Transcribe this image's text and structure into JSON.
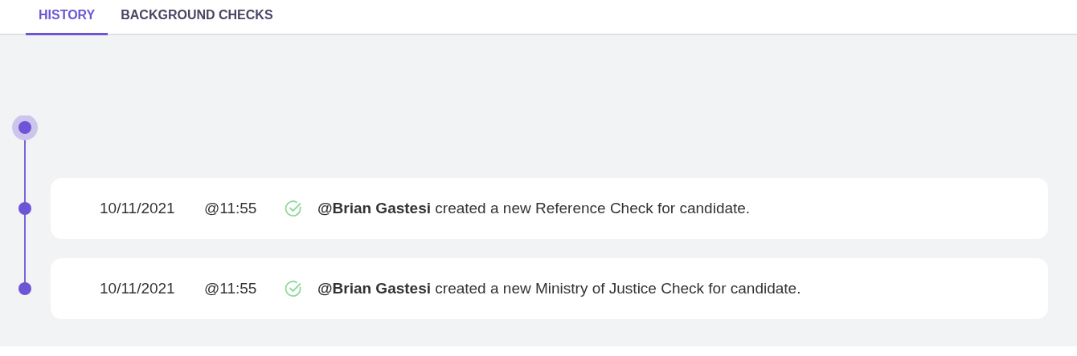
{
  "tabs": [
    {
      "label": "HISTORY",
      "selected": true
    },
    {
      "label": "BACKGROUND CHECKS",
      "selected": false
    }
  ],
  "history": [
    {
      "date": "10/11/2021",
      "time": "@11:55",
      "message": "**@Brian Gastesi** created a new Reference Check for candidate."
    },
    {
      "date": "10/11/2021",
      "time": "@11:55",
      "message": "**@Brian Gastesi** created a new Ministry of Justice Check for candidate."
    }
  ]
}
